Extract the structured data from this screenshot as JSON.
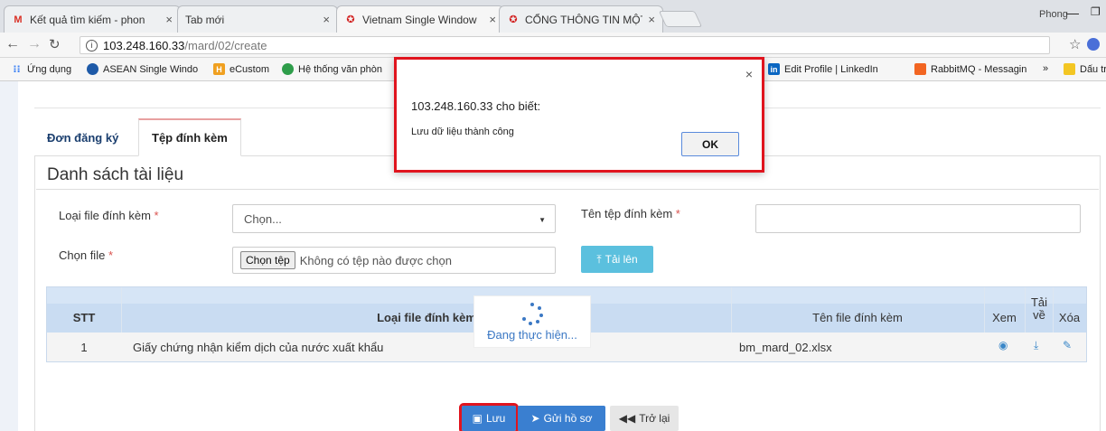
{
  "browser": {
    "tabs": [
      {
        "icon": "gmail-icon",
        "title": "Kết quả tìm kiếm - phon",
        "active": false
      },
      {
        "icon": "",
        "title": "Tab mới",
        "active": false
      },
      {
        "icon": "vietnam-emblem-icon",
        "title": "Vietnam Single Window",
        "active": true
      },
      {
        "icon": "vietnam-emblem-icon",
        "title": "CỔNG THÔNG TIN MỘT",
        "active": false
      }
    ],
    "user": "Phong",
    "address_host": "103.248.160.33",
    "address_path": "/mard/02/create",
    "bookmarks": [
      {
        "label": "Ứng dụng",
        "color": "#4285f4"
      },
      {
        "label": "ASEAN Single Windo",
        "color": "#1e5aa8"
      },
      {
        "label": "eCustom",
        "color": "#f0a020"
      },
      {
        "label": "Hệ thống văn phòn",
        "color": "#2e9d4a"
      },
      {
        "label": "Edit Profile | LinkedIn",
        "color": "#0a66c2"
      },
      {
        "label": "RabbitMQ - Messagin",
        "color": "#f26522"
      },
      {
        "label": "»",
        "color": ""
      },
      {
        "label": "Dấu trang",
        "color": "#f3c623"
      }
    ]
  },
  "page": {
    "tabs": [
      "Đơn đăng ký",
      "Tệp đính kèm"
    ],
    "section_title": "Danh sách tài liệu",
    "form": {
      "file_type_label": "Loại file đính kèm",
      "file_type_value": "Chọn...",
      "file_name_label": "Tên tệp đính kèm",
      "choose_file_label": "Chọn file",
      "choose_file_button": "Chọn tệp",
      "no_file_text": "Không có tệp nào được chọn",
      "upload_button": "Tải lên",
      "required_mark": "*"
    },
    "table": {
      "headers": {
        "stt": "STT",
        "file_type": "Loại file đính kèm",
        "file_name": "Tên file đính kèm",
        "view": "Xem",
        "download": "Tải về",
        "delete": "Xóa"
      },
      "rows": [
        {
          "stt": "1",
          "file_type": "Giấy chứng nhận kiểm dịch của nước xuất khẩu",
          "file_name": "bm_mard_02.xlsx"
        }
      ]
    },
    "loading_text": "Đang thực hiện...",
    "buttons": {
      "save": "Lưu",
      "send": "Gửi hồ sơ",
      "back": "Trở lại"
    }
  },
  "dialog": {
    "title": "103.248.160.33 cho biết:",
    "message": "Lưu dữ liệu thành công",
    "ok": "OK"
  },
  "colors": {
    "highlight": "#e0141e",
    "primary": "#3a7fd0",
    "info": "#5bc0de",
    "table_header": "#c9dcf2"
  }
}
